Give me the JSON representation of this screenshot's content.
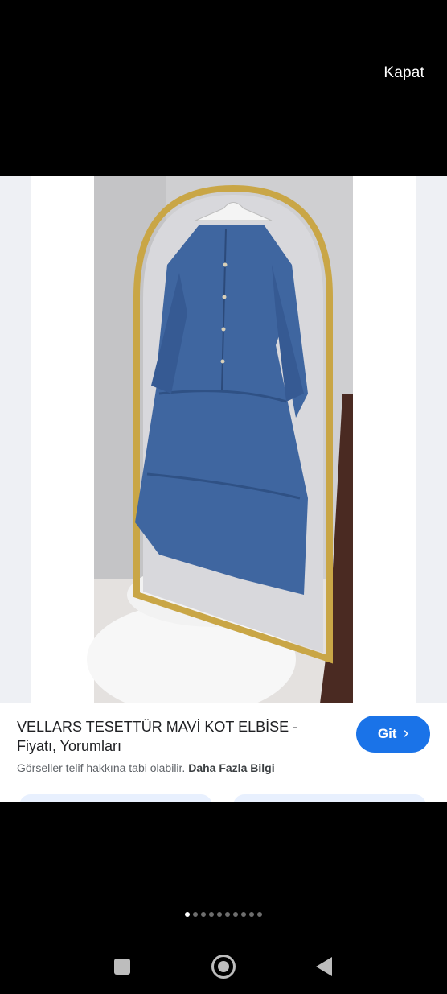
{
  "header": {
    "close_label": "Kapat"
  },
  "image": {
    "description_icon": "dress-photo",
    "dress_color": "#3f66a0"
  },
  "result": {
    "title_line1": "VELLARS TESETTÜR MAVİ KOT ELBİSE -",
    "title_line2": "Fiyatı, Yorumları",
    "go_label": "Git",
    "go_icon": "chevron-right-icon",
    "copyright_text": "Görseller telif hakkına tabi olabilir.",
    "more_info_label": "Daha Fazla Bilgi"
  },
  "pager": {
    "count": 10,
    "active_index": 0
  },
  "navbar": {
    "recent_icon": "recent-apps-icon",
    "home_icon": "home-icon",
    "back_icon": "back-icon"
  },
  "colors": {
    "accent": "#1a73e8",
    "background": "#000000"
  }
}
